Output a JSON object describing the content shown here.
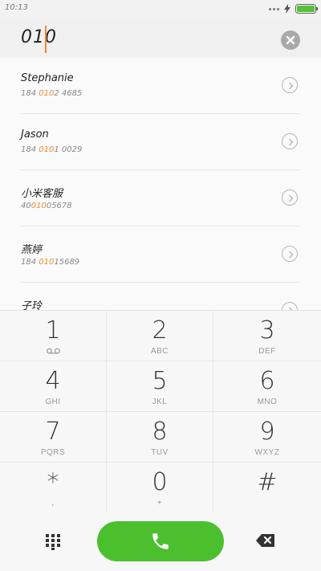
{
  "status_bar": {
    "time": "10:13"
  },
  "dialer": {
    "typed_number": "010"
  },
  "contacts": [
    {
      "name": "Stephanie",
      "number_before": "184 ",
      "number_match": "010",
      "number_after": "2 4685"
    },
    {
      "name": "Jason",
      "number_before": "184 ",
      "number_match": "010",
      "number_after": "1 0029"
    },
    {
      "name": "小米客服",
      "number_before": "40",
      "number_match": "010",
      "number_after": "05678"
    },
    {
      "name": "燕婷",
      "number_before": "184 ",
      "number_match": "010",
      "number_after": "15689"
    },
    {
      "name": "子玲",
      "number_before": "",
      "number_match": "",
      "number_after": ""
    }
  ],
  "keypad": {
    "keys": [
      {
        "digit": "1",
        "letters": ""
      },
      {
        "digit": "2",
        "letters": "ABC"
      },
      {
        "digit": "3",
        "letters": "DEF"
      },
      {
        "digit": "4",
        "letters": "GHI"
      },
      {
        "digit": "5",
        "letters": "JKL"
      },
      {
        "digit": "6",
        "letters": "MNO"
      },
      {
        "digit": "7",
        "letters": "PQRS"
      },
      {
        "digit": "8",
        "letters": "TUV"
      },
      {
        "digit": "9",
        "letters": "WXYZ"
      },
      {
        "digit": "*",
        "letters": ","
      },
      {
        "digit": "0",
        "letters": "+"
      },
      {
        "digit": "#",
        "letters": ""
      }
    ]
  },
  "icons": {
    "voicemail": "voicemail-icon",
    "clear": "clear-icon",
    "chevron": "chevron-right-icon",
    "dialpad": "dialpad-grid-icon",
    "call": "phone-icon",
    "backspace": "backspace-icon"
  },
  "colors": {
    "accent": "#f28a2d",
    "call_green": "#4cbf2e",
    "battery_green": "#55c23a"
  }
}
